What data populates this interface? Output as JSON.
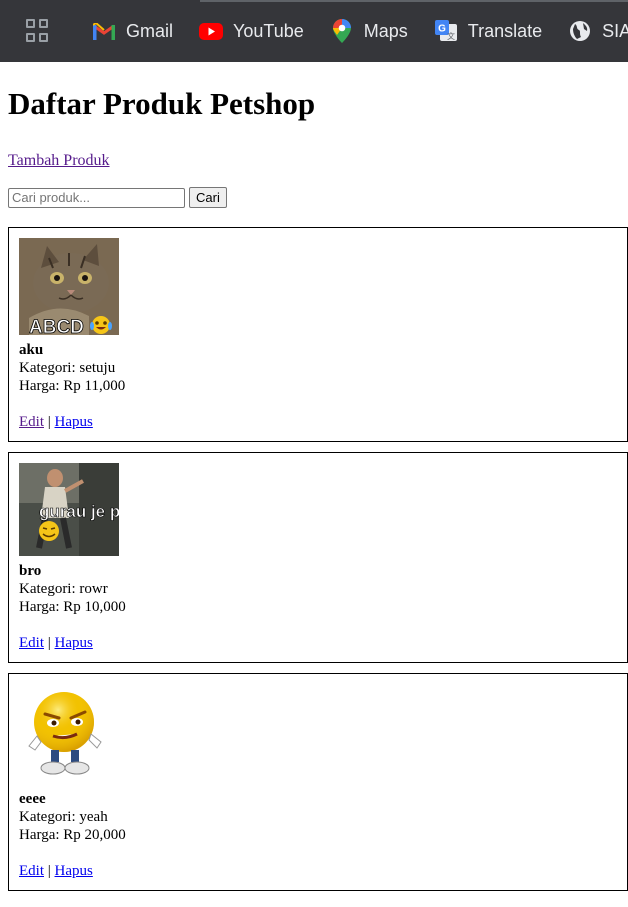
{
  "bookmarks": [
    {
      "label": "Gmail",
      "icon": "gmail-icon"
    },
    {
      "label": "YouTube",
      "icon": "youtube-icon"
    },
    {
      "label": "Maps",
      "icon": "maps-icon"
    },
    {
      "label": "Translate",
      "icon": "translate-icon"
    },
    {
      "label": "SIAKI",
      "icon": "globe-icon"
    }
  ],
  "page": {
    "title": "Daftar Produk Petshop",
    "add_link": "Tambah Produk",
    "search_placeholder": "Cari produk...",
    "search_button": "Cari"
  },
  "products": [
    {
      "name": "aku",
      "category": "Kategori: setuju",
      "price": "Harga: Rp 11,000",
      "edit": "Edit",
      "sep": "|",
      "delete": "Hapus",
      "image_caption": "ABCD"
    },
    {
      "name": "bro",
      "category": "Kategori: rowr",
      "price": "Harga: Rp 10,000",
      "edit": "Edit",
      "sep": "|",
      "delete": "Hapus",
      "image_caption": "gurau je pun"
    },
    {
      "name": "eeee",
      "category": "Kategori: yeah",
      "price": "Harga: Rp 20,000",
      "edit": "Edit",
      "sep": "|",
      "delete": "Hapus",
      "image_caption": ""
    }
  ],
  "colors": {
    "toolbar": "#35363a",
    "link": "#0000ee",
    "visited_link": "#551a8b"
  }
}
